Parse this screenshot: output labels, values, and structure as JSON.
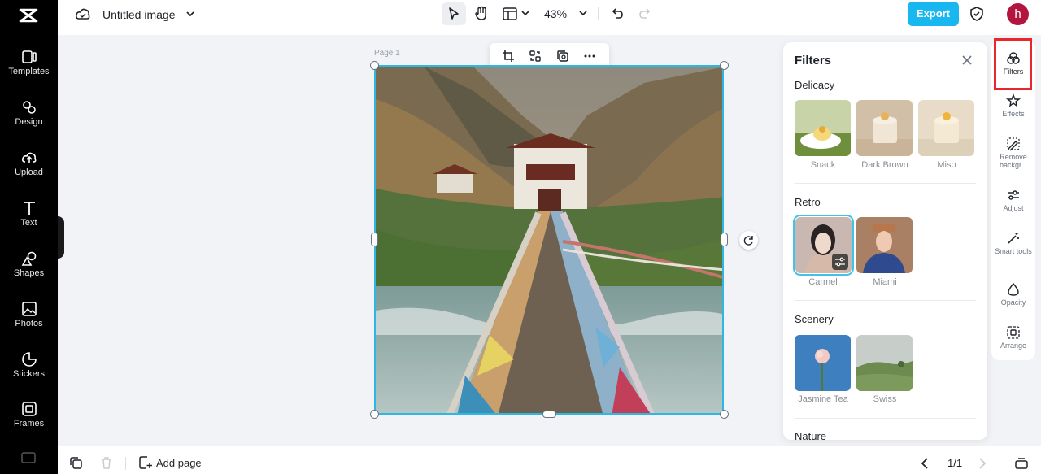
{
  "sidebar": {
    "items": [
      {
        "label": "Templates",
        "icon": "templates-icon"
      },
      {
        "label": "Design",
        "icon": "design-icon"
      },
      {
        "label": "Upload",
        "icon": "upload-icon"
      },
      {
        "label": "Text",
        "icon": "text-icon"
      },
      {
        "label": "Shapes",
        "icon": "shapes-icon"
      },
      {
        "label": "Photos",
        "icon": "photos-icon"
      },
      {
        "label": "Stickers",
        "icon": "stickers-icon"
      },
      {
        "label": "Frames",
        "icon": "frames-icon"
      }
    ]
  },
  "header": {
    "doc_title": "Untitled image",
    "zoom": "43%",
    "export_label": "Export",
    "avatar_initial": "h"
  },
  "canvas": {
    "page_label": "Page 1"
  },
  "footer": {
    "add_page_label": "Add page",
    "page_count": "1/1"
  },
  "filters_panel": {
    "title": "Filters",
    "sections": [
      {
        "title": "Delicacy",
        "items": [
          "Snack",
          "Dark Brown",
          "Miso"
        ]
      },
      {
        "title": "Retro",
        "items": [
          "Carmel",
          "Miami"
        ]
      },
      {
        "title": "Scenery",
        "items": [
          "Jasmine Tea",
          "Swiss"
        ]
      },
      {
        "title": "Nature",
        "items": []
      }
    ]
  },
  "right_rail": {
    "items": [
      "Filters",
      "Effects",
      "Remove backgr...",
      "Adjust",
      "Smart tools",
      "Opacity",
      "Arrange"
    ]
  },
  "colors": {
    "accent": "#19b7f0",
    "selection": "#2fb7e3",
    "highlight": "#e8262b",
    "avatar": "#b3153f"
  }
}
